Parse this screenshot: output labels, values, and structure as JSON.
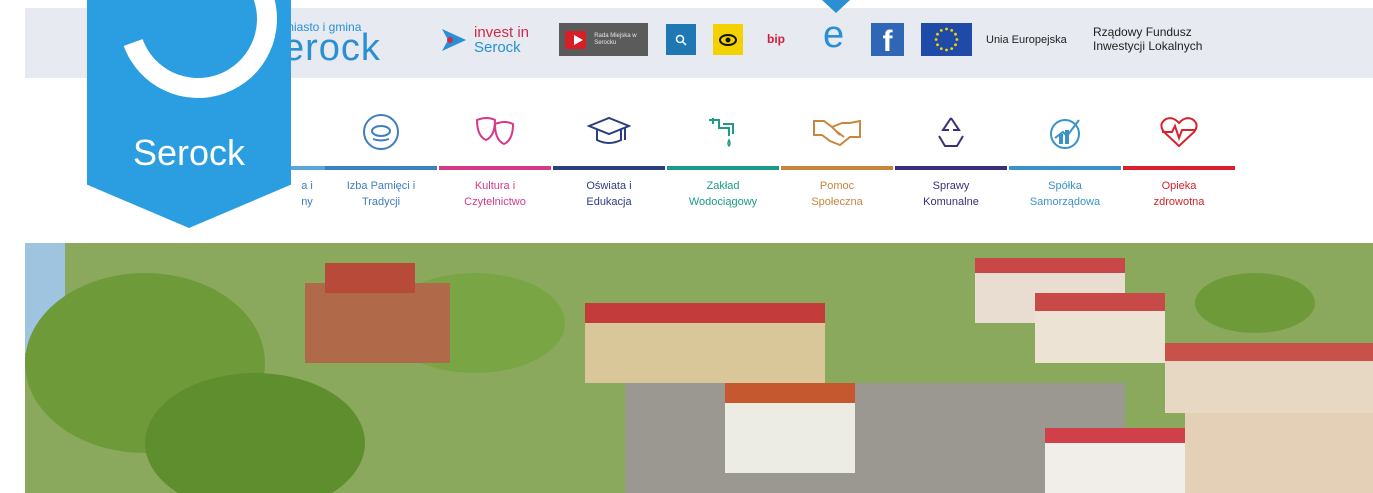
{
  "header": {
    "brand_small": "miasto i gmina",
    "brand_big": "erock",
    "invest_line1": "invest in",
    "invest_line2": "Serock",
    "rada_label": "Rada Miejska w Serocku",
    "bip_label": "bip",
    "e_label": "e",
    "facebook_label": "f",
    "eu_label": "Unia Europejska",
    "fund_line1": "Rządowy Fundusz",
    "fund_line2": "Inwestycji Lokalnych"
  },
  "shield": {
    "name": "Serock"
  },
  "categories": [
    {
      "line1": "a i",
      "line2": "ny",
      "color": "#5aa6d8"
    },
    {
      "line1": "Izba Pamięci i",
      "line2": "Tradycji",
      "color": "#3d7fc0"
    },
    {
      "line1": "Kultura i",
      "line2": "Czytelnictwo",
      "color": "#d63a86"
    },
    {
      "line1": "Oświata i",
      "line2": "Edukacja",
      "color": "#2b3f7e"
    },
    {
      "line1": "Zakład",
      "line2": "Wodociągowy",
      "color": "#1c9a8a"
    },
    {
      "line1": "Pomoc",
      "line2": "Społeczna",
      "color": "#c8873a"
    },
    {
      "line1": "Sprawy",
      "line2": "Komunalne",
      "color": "#3a2f7a"
    },
    {
      "line1": "Spółka",
      "line2": "Samorządowa",
      "color": "#3a93c8"
    },
    {
      "line1": "Opieka",
      "line2": "zdrowotna",
      "color": "#d8212c"
    }
  ],
  "colors": {
    "brand": "#2a9ee0",
    "topbar": "#e7eaf1"
  },
  "icons": [
    "play-icon",
    "search-icon",
    "eye-icon",
    "e-icon",
    "facebook-icon",
    "eu-flag-icon"
  ]
}
